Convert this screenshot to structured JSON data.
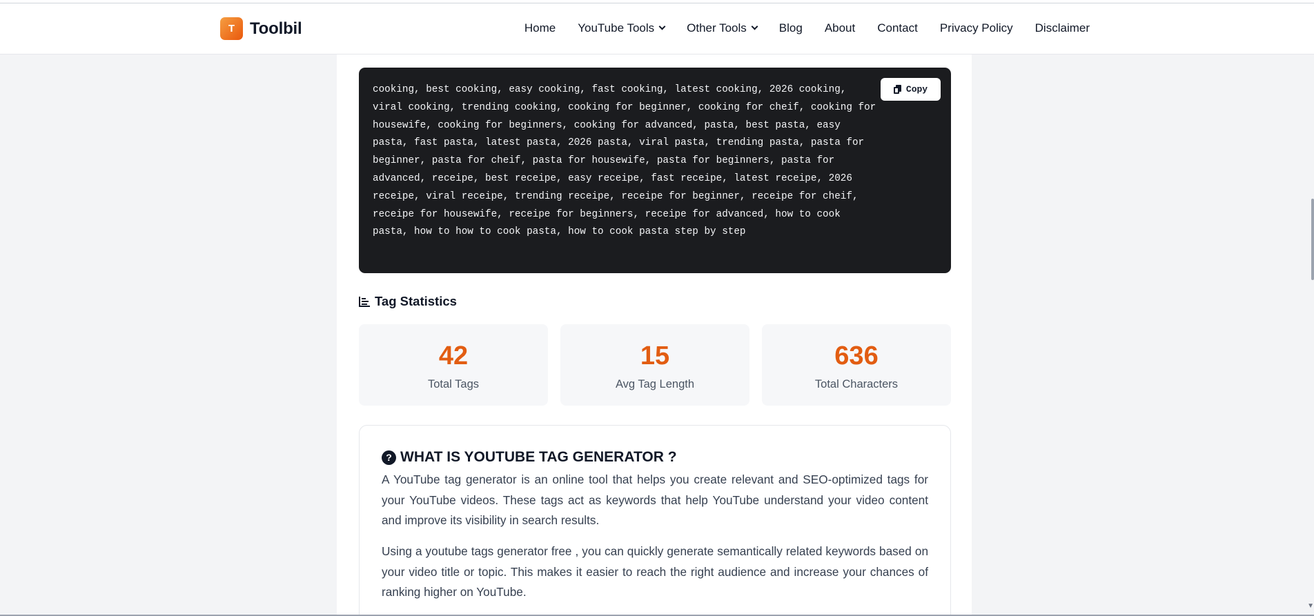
{
  "brand": {
    "logo_letter": "T",
    "name": "Toolbil"
  },
  "nav": {
    "home": "Home",
    "youtube_tools": "YouTube Tools",
    "other_tools": "Other Tools",
    "blog": "Blog",
    "about": "About",
    "contact": "Contact",
    "privacy": "Privacy Policy",
    "disclaimer": "Disclaimer"
  },
  "tags": {
    "text": "cooking, best cooking, easy cooking, fast cooking, latest cooking, 2026 cooking, viral cooking, trending cooking, cooking for beginner, cooking for cheif, cooking for housewife, cooking for beginners, cooking for advanced, pasta, best pasta, easy pasta, fast pasta, latest pasta, 2026 pasta, viral pasta, trending pasta, pasta for beginner, pasta for cheif, pasta for housewife, pasta for beginners, pasta for advanced, receipe, best receipe, easy receipe, fast receipe, latest receipe, 2026 receipe, viral receipe, trending receipe, receipe for beginner, receipe for cheif, receipe for housewife, receipe for beginners, receipe for advanced, how to cook pasta, how to how to cook pasta, how to cook pasta step by step",
    "copy_label": "Copy"
  },
  "stats": {
    "title": "Tag Statistics",
    "total_tags": {
      "value": "42",
      "label": "Total Tags"
    },
    "avg_length": {
      "value": "15",
      "label": "Avg Tag Length"
    },
    "total_chars": {
      "value": "636",
      "label": "Total Characters"
    }
  },
  "what": {
    "title": "WHAT IS YOUTUBE TAG GENERATOR ?",
    "icon_glyph": "?",
    "p1": "A YouTube tag generator is an online tool that helps you create relevant and SEO-optimized tags for your YouTube videos. These tags act as keywords that help YouTube understand your video content and improve its visibility in search results.",
    "p2": "Using a youtube tags generator free , you can quickly generate semantically related keywords based on your video title or topic. This makes it easier to reach the right audience and increase your chances of ranking higher on YouTube."
  },
  "colors": {
    "accent": "#e25d12",
    "logo_gradient_start": "#f59e42",
    "logo_gradient_end": "#ea580c",
    "code_bg": "#1b1c1f"
  }
}
